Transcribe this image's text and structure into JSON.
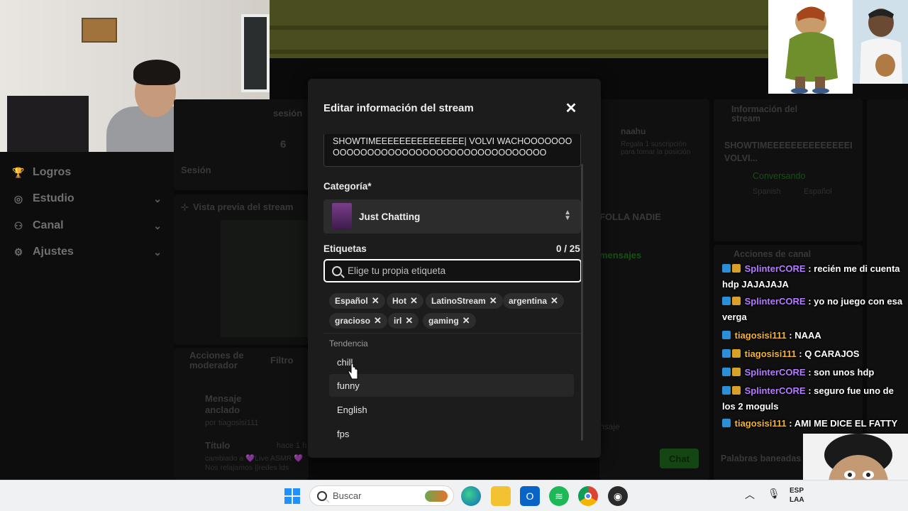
{
  "sidebar": {
    "items": [
      {
        "label": "Logros",
        "icon": "trophy-icon",
        "chevron": false
      },
      {
        "label": "Estudio",
        "icon": "camera-icon",
        "chevron": true
      },
      {
        "label": "Canal",
        "icon": "users-icon",
        "chevron": true
      },
      {
        "label": "Ajustes",
        "icon": "gear-icon",
        "chevron": true
      }
    ]
  },
  "background": {
    "session_label": "sesión",
    "session_value": "6",
    "session_sub": "Sesión",
    "preview_label": "Vista previa del stream",
    "mod_actions": "Acciones de moderador",
    "filter": "Filtro",
    "pinned": "Mensaje anclado",
    "pinned_by": "por tiagosisi111",
    "title_label": "Título",
    "title_time": "hace 1 h",
    "title_change": "cambiado a 💜Live ASMR 💜 Nos relajamos  ||redes lds",
    "chat_user": "naahu",
    "chat_gift": "Regala 1 suscripción para tomar la posición",
    "chat_msg": "FOLLA NADIE",
    "chat_messages_tab": "mensajes",
    "chat_input_placeholder": "nsaje",
    "chat_button": "Chat",
    "info_title": "Información del stream",
    "info_stream_title": "SHOWTIMEEEEEEEEEEEEEEI VOLVI...",
    "info_category": "Conversando",
    "info_tags": [
      "Spanish",
      "Español"
    ],
    "channel_actions": "Acciones de canal",
    "banned_words": "Palabras baneadas"
  },
  "modal": {
    "title": "Editar información del stream",
    "stream_title_value": "SHOWTIMEEEEEEEEEEEEEEE| VOLVI WACHOOOOOOOOOOOOOOOOOOOOOOOOOOOOOOOOOOOOOO",
    "category_label": "Categoría*",
    "category_value": "Just Chatting",
    "tags_label": "Etiquetas",
    "tags_count": "0 / 25",
    "tags_placeholder": "Elige tu propia etiqueta",
    "tags": [
      "Español",
      "Hot",
      "LatinoStream",
      "argentina",
      "gracioso",
      "irl",
      "gaming"
    ],
    "suggest_header": "Tendencia",
    "suggestions": [
      "chill",
      "funny",
      "English",
      "fps"
    ],
    "close_glyph": "✕"
  },
  "chat_overlay": [
    {
      "user": "SplinterCORE",
      "color": "purple",
      "text": ": recién me di cuenta hdp JAJAJAJA"
    },
    {
      "user": "SplinterCORE",
      "color": "purple",
      "text": ": yo no juego con esa verga"
    },
    {
      "user": "tiagosisi111",
      "color": "gold",
      "text": ": NAAA"
    },
    {
      "user": "tiagosisi111",
      "color": "gold",
      "text": ": Q CARAJOS"
    },
    {
      "user": "SplinterCORE",
      "color": "purple",
      "text": ": son unos hdp"
    },
    {
      "user": "SplinterCORE",
      "color": "purple",
      "text": ": seguro fue uno de los 2 moguls"
    },
    {
      "user": "tiagosisi111",
      "color": "gold",
      "text": ": AMI ME DICE EL FATTY"
    }
  ],
  "taskbar": {
    "search_placeholder": "Buscar",
    "tray_lang": "ESP\nLAA",
    "apps": [
      "windows-start-icon",
      "edge-icon",
      "file-explorer-icon",
      "outlook-icon",
      "spotify-icon",
      "chrome-icon",
      "obs-icon"
    ]
  },
  "colors": {
    "modal_bg": "#1b1c1b",
    "accent_green": "#1fc41f",
    "purple_user": "#b67cff",
    "gold_user": "#f0b33c"
  }
}
